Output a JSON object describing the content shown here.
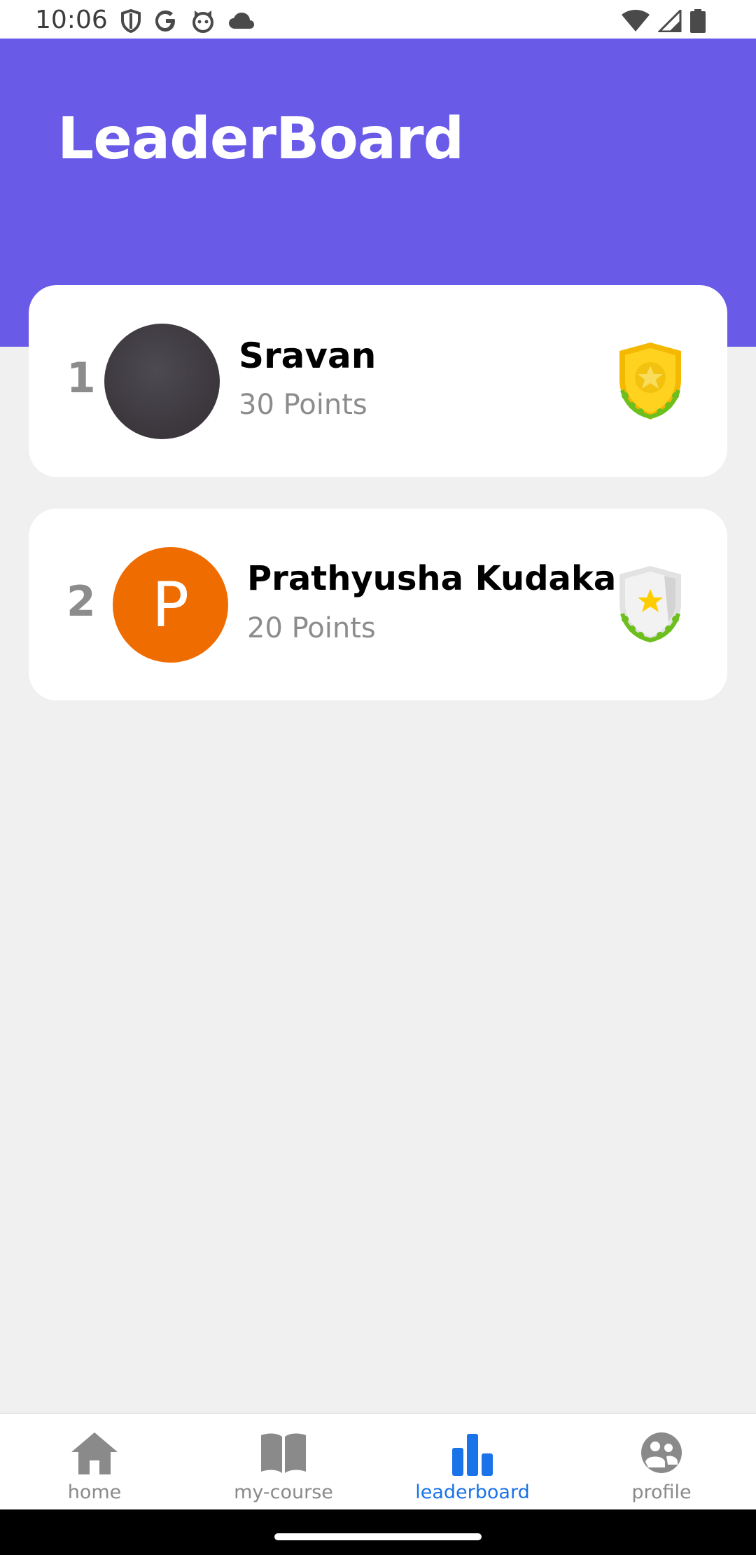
{
  "status_bar": {
    "time": "10:06",
    "left_icons": [
      "shield-icon",
      "google-icon",
      "cat-icon",
      "cloud-icon"
    ],
    "right_icons": [
      "wifi-icon",
      "signal-icon",
      "battery-icon"
    ]
  },
  "header": {
    "title": "LeaderBoard",
    "background_color": "#6a5ae8"
  },
  "leaderboard": [
    {
      "rank": "1",
      "name": "Sravan",
      "points": "30 Points",
      "avatar": "photo",
      "badge": "gold-badge-icon"
    },
    {
      "rank": "2",
      "name": "Prathyusha Kudaka",
      "points": "20 Points",
      "avatar_initial": "P",
      "avatar_color": "#ef6c00",
      "badge": "silver-badge-icon"
    }
  ],
  "bottom_nav": {
    "items": [
      {
        "label": "home",
        "icon": "home-icon",
        "active": false
      },
      {
        "label": "my-course",
        "icon": "book-icon",
        "active": false
      },
      {
        "label": "leaderboard",
        "icon": "bar-chart-icon",
        "active": true
      },
      {
        "label": "profile",
        "icon": "profile-icon",
        "active": false
      }
    ],
    "active_color": "#1a73e8"
  }
}
